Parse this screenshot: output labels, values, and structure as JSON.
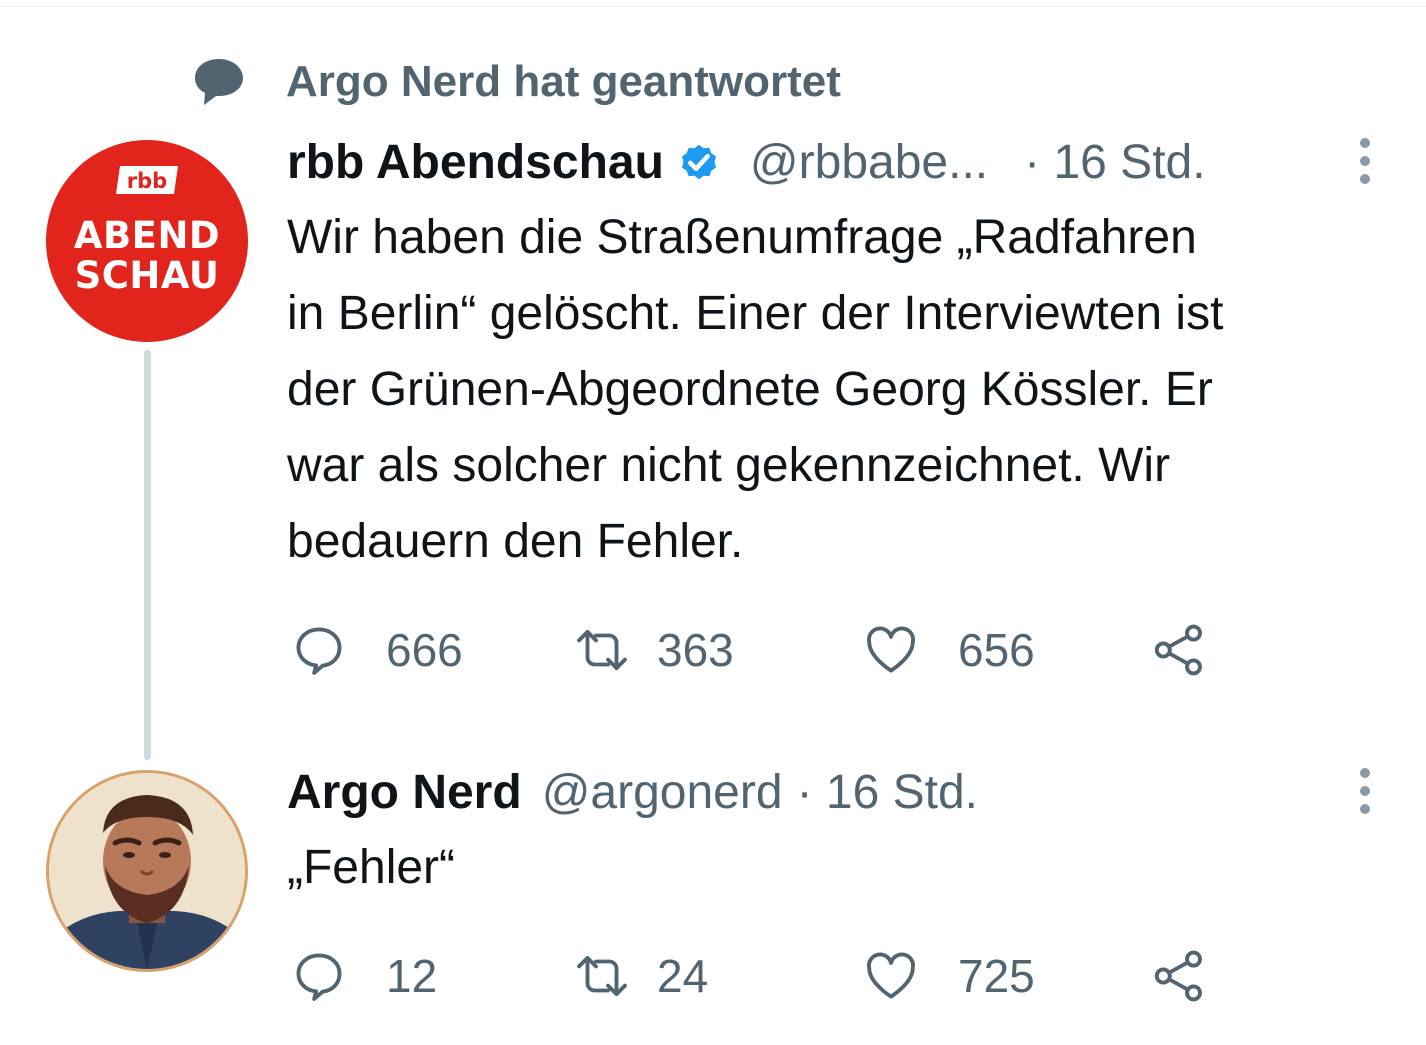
{
  "context": {
    "text": "Argo Nerd hat geantwortet",
    "icon": "speech-bubble-icon"
  },
  "tweets": [
    {
      "name": "rbb Abendschau",
      "verified": true,
      "handle": "@rbbabe...",
      "time": "· 16 Std.",
      "avatar": {
        "logo_text": "rbb",
        "line1": "ABEND",
        "line2": "SCHAU",
        "bg_color": "#e1241c"
      },
      "text_lines": [
        "Wir haben die Straßenumfrage „Radfahren",
        "in Berlin“ gelöscht. Einer der Interviewten ist",
        "der Grünen-Abgeordnete Georg Kössler. Er",
        "war als solcher nicht gekennzeichnet. Wir",
        "bedauern den Fehler."
      ],
      "stats": {
        "replies": "666",
        "retweets": "363",
        "likes": "656"
      }
    },
    {
      "name": "Argo Nerd",
      "verified": false,
      "handle": "@argonerd",
      "time": "· 16 Std.",
      "text_lines": [
        "„Fehler“"
      ],
      "stats": {
        "replies": "12",
        "retweets": "24",
        "likes": "725"
      }
    }
  ],
  "colors": {
    "verified": "#1d9bf0",
    "secondary_text": "#536471",
    "thread_line": "#cfd9de"
  }
}
